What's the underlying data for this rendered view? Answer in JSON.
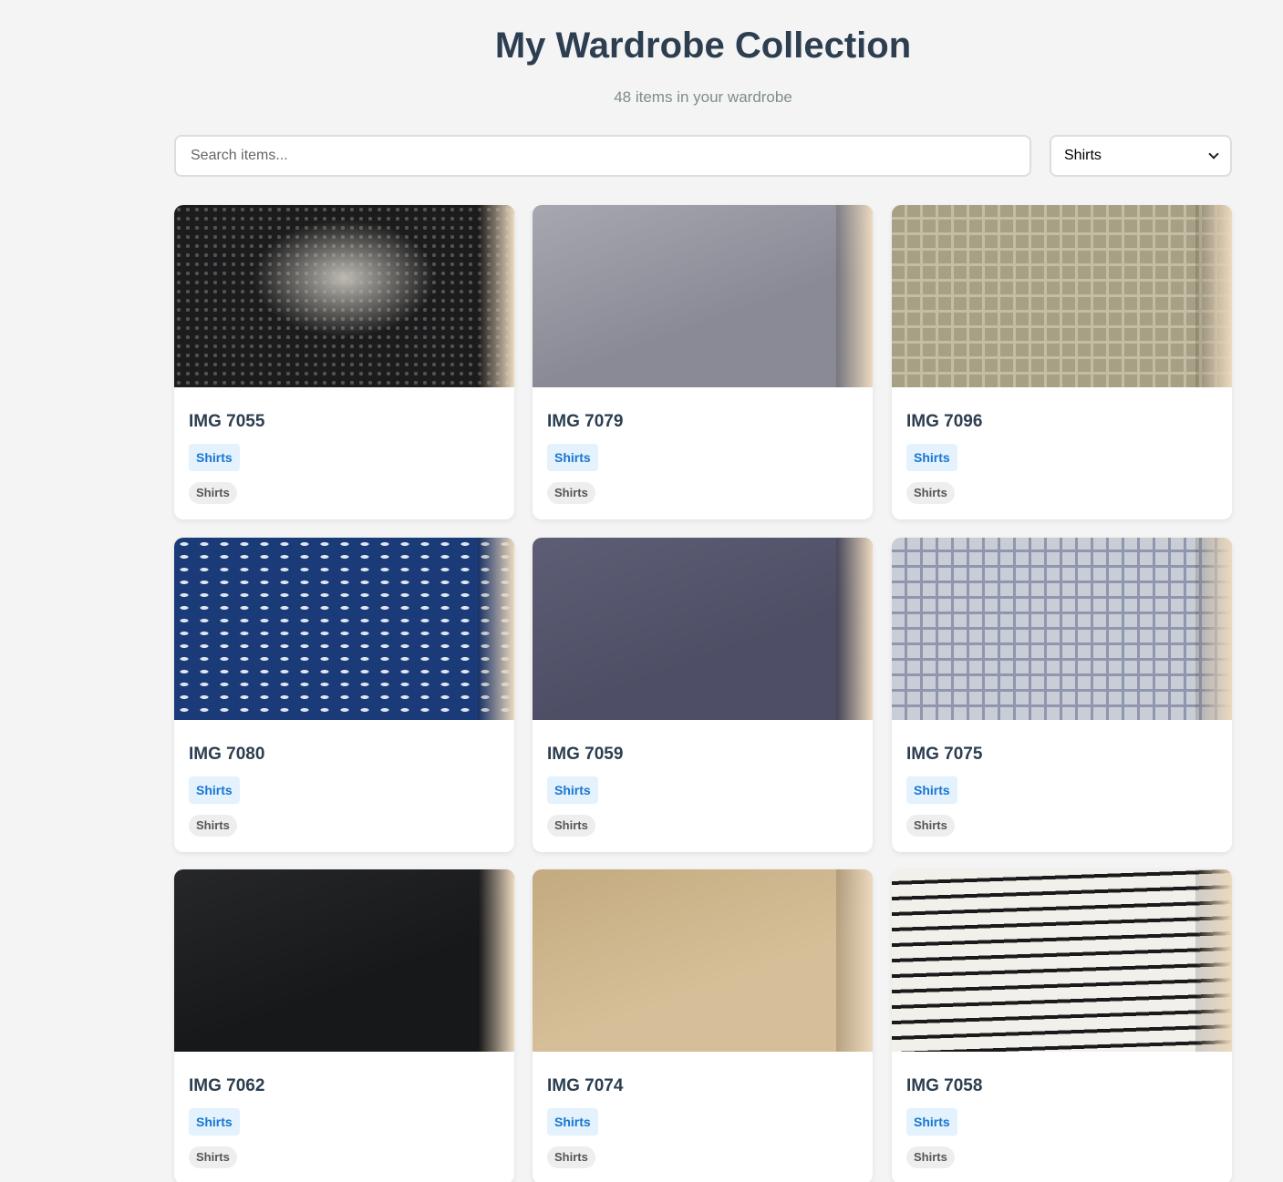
{
  "header": {
    "title": "My Wardrobe Collection",
    "subtitle": "48 items in your wardrobe"
  },
  "controls": {
    "search_placeholder": "Search items...",
    "category_selected": "Shirts"
  },
  "items": [
    {
      "name": "IMG 7055",
      "category": "Shirts",
      "tag": "Shirts",
      "colors": [
        "#1c1c1e",
        "#bdbab2"
      ],
      "pattern": "paisley"
    },
    {
      "name": "IMG 7079",
      "category": "Shirts",
      "tag": "Shirts",
      "colors": [
        "#8a8a96",
        "#a7a7b0"
      ],
      "pattern": "solid"
    },
    {
      "name": "IMG 7096",
      "category": "Shirts",
      "tag": "Shirts",
      "colors": [
        "#a8a085",
        "#c4bda3"
      ],
      "pattern": "check"
    },
    {
      "name": "IMG 7080",
      "category": "Shirts",
      "tag": "Shirts",
      "colors": [
        "#1b3a78",
        "#dfe6f2"
      ],
      "pattern": "dots"
    },
    {
      "name": "IMG 7059",
      "category": "Shirts",
      "tag": "Shirts",
      "colors": [
        "#4e4f66",
        "#5d5e75"
      ],
      "pattern": "solid"
    },
    {
      "name": "IMG 7075",
      "category": "Shirts",
      "tag": "Shirts",
      "colors": [
        "#c9cdd6",
        "#8f97ae"
      ],
      "pattern": "check"
    },
    {
      "name": "IMG 7062",
      "category": "Shirts",
      "tag": "Shirts",
      "colors": [
        "#17181a",
        "#262729"
      ],
      "pattern": "solid"
    },
    {
      "name": "IMG 7074",
      "category": "Shirts",
      "tag": "Shirts",
      "colors": [
        "#d6bf98",
        "#c3aa80"
      ],
      "pattern": "solid"
    },
    {
      "name": "IMG 7058",
      "category": "Shirts",
      "tag": "Shirts",
      "colors": [
        "#f2f0ea",
        "#1a1a1a"
      ],
      "pattern": "stripes"
    }
  ]
}
